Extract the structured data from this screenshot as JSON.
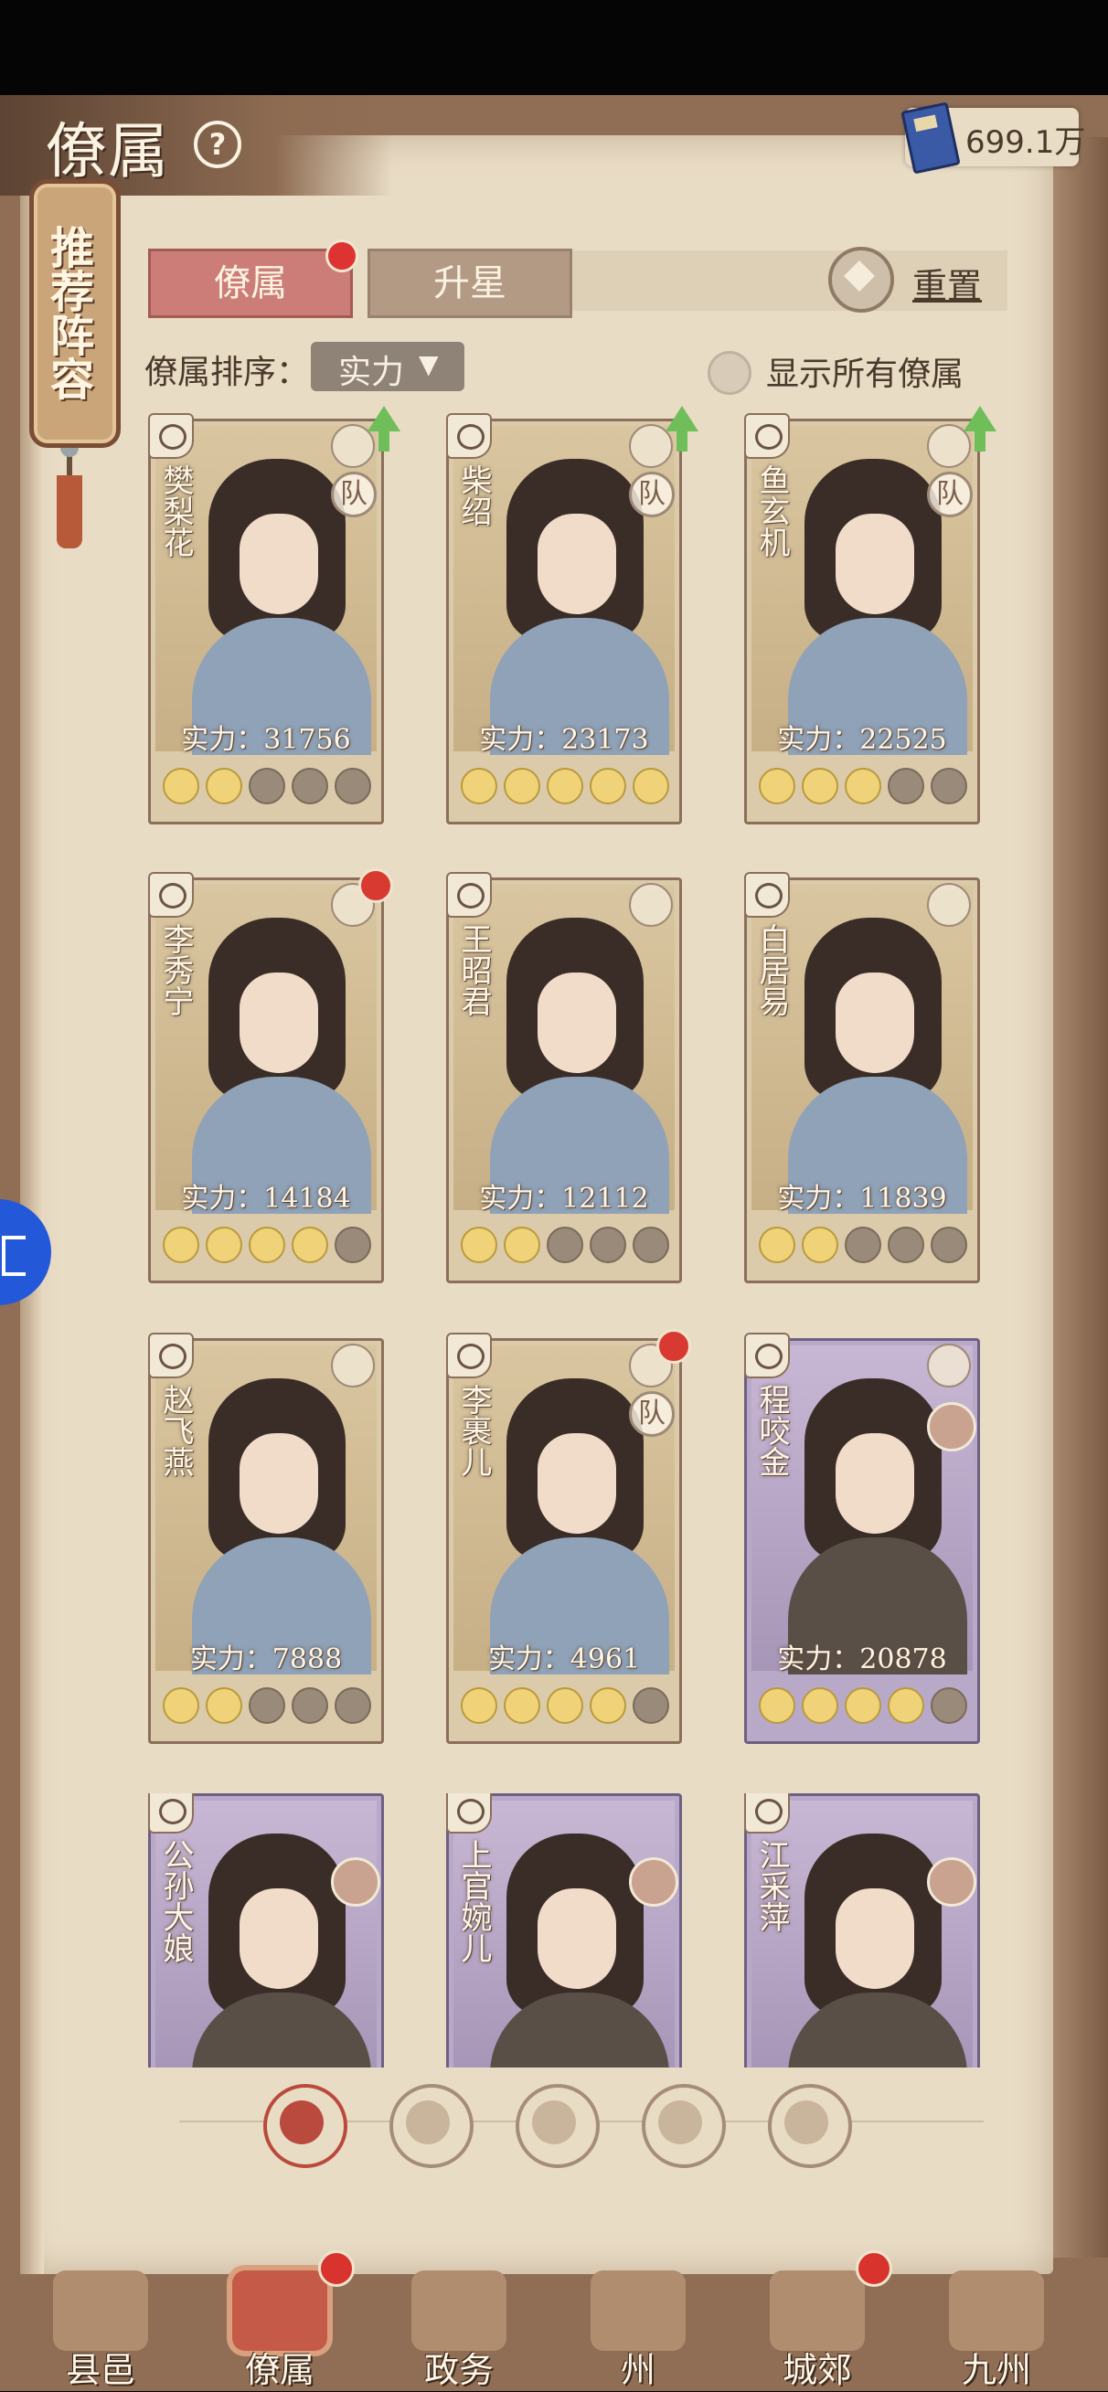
{
  "header": {
    "title": "僚属",
    "gold": "699.1万"
  },
  "sidebar": {
    "recommend_label": "推荐阵容"
  },
  "tabs": [
    {
      "label": "僚属",
      "active": true,
      "badge": true
    },
    {
      "label": "升星",
      "active": false
    }
  ],
  "reset_label": "重置",
  "sort": {
    "label": "僚属排序：",
    "value": "实力",
    "caret": "▼"
  },
  "show_all_label": "显示所有僚属",
  "cards": [
    {
      "name": "樊梨花",
      "power": "实力：31756",
      "stars": 2,
      "team": "队",
      "upgrade": true,
      "badge": false,
      "purple": false
    },
    {
      "name": "柴绍",
      "power": "实力：23173",
      "stars": 5,
      "team": "队",
      "upgrade": true,
      "badge": false,
      "purple": false
    },
    {
      "name": "鱼玄机",
      "power": "实力：22525",
      "stars": 3,
      "team": "队",
      "upgrade": true,
      "badge": false,
      "purple": false
    },
    {
      "name": "李秀宁",
      "power": "实力：14184",
      "stars": 4,
      "team": "",
      "upgrade": false,
      "badge": true,
      "purple": false
    },
    {
      "name": "王昭君",
      "power": "实力：12112",
      "stars": 2,
      "team": "",
      "upgrade": false,
      "badge": false,
      "purple": false
    },
    {
      "name": "白居易",
      "power": "实力：11839",
      "stars": 2,
      "team": "",
      "upgrade": false,
      "badge": false,
      "purple": false
    },
    {
      "name": "赵飞燕",
      "power": "实力：7888",
      "stars": 2,
      "team": "",
      "upgrade": false,
      "badge": false,
      "purple": false
    },
    {
      "name": "李裹儿",
      "power": "实力：4961",
      "stars": 4,
      "team": "队",
      "upgrade": false,
      "badge": true,
      "purple": false
    },
    {
      "name": "程咬金",
      "power": "实力：20878",
      "stars": 4,
      "team": "",
      "upgrade": false,
      "badge": false,
      "purple": true
    },
    {
      "name": "公孙大娘",
      "power": "",
      "stars": 0,
      "team": "",
      "upgrade": false,
      "badge": false,
      "purple": true
    },
    {
      "name": "上官婉儿",
      "power": "",
      "stars": 0,
      "team": "",
      "upgrade": false,
      "badge": false,
      "purple": true
    },
    {
      "name": "江采萍",
      "power": "",
      "stars": 0,
      "team": "",
      "upgrade": false,
      "badge": false,
      "purple": true
    }
  ],
  "filters": [
    "filter-all",
    "filter-faction-1",
    "filter-faction-2",
    "filter-faction-3",
    "filter-faction-4"
  ],
  "bottom_nav": [
    {
      "label": "县邑",
      "badge": false,
      "active": false
    },
    {
      "label": "僚属",
      "badge": true,
      "active": true
    },
    {
      "label": "政务",
      "badge": false,
      "active": false
    },
    {
      "label": "州",
      "badge": false,
      "active": false
    },
    {
      "label": "城郊",
      "badge": true,
      "active": false
    },
    {
      "label": "九州",
      "badge": false,
      "active": false
    }
  ],
  "colors": {
    "accent": "#cc7d77",
    "page": "#e9dcc5",
    "badge": "#d8332c",
    "upgrade": "#6fbe5a"
  }
}
